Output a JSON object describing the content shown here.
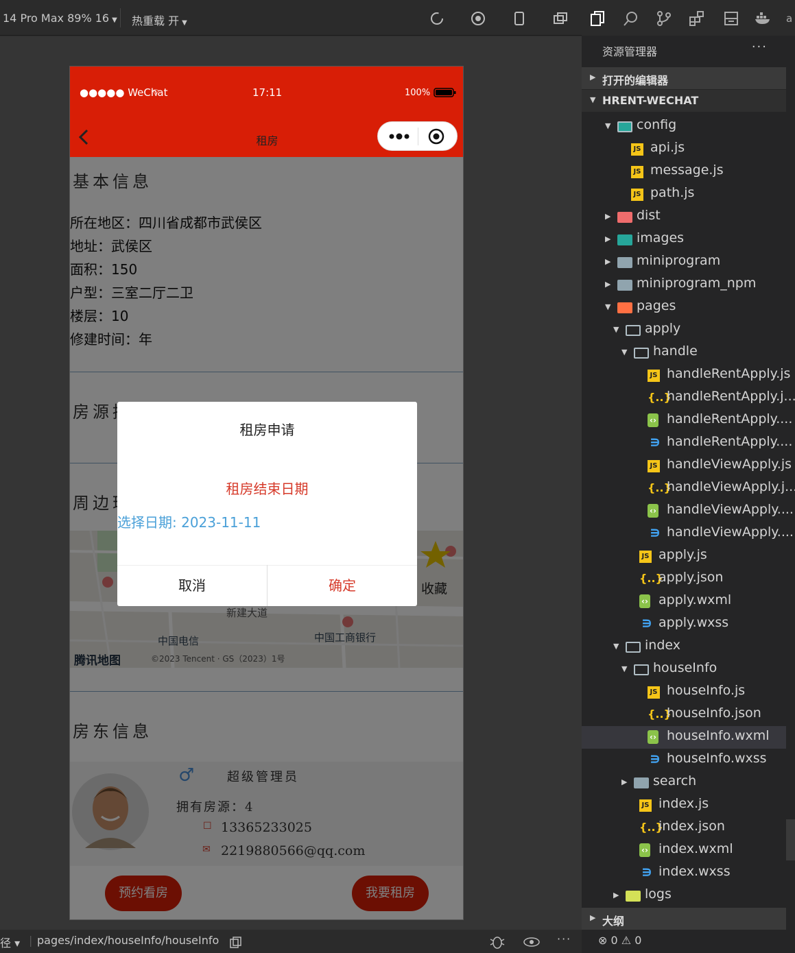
{
  "toolbar": {
    "device": "14 Pro Max 89% 16",
    "hot_reload": "热重载 开"
  },
  "phone": {
    "status": {
      "carrier": "●●●●● WeChat",
      "time": "17:11",
      "battery": "100%"
    },
    "nav_title": "租房",
    "basic": {
      "title": "基本信息",
      "lines": [
        "所在地区：四川省成都市武侯区",
        "地址：武侯区",
        "面积：150",
        "户型：三室二厅二卫",
        "楼层：10",
        "修建时间：年"
      ]
    },
    "desc_title": "房源描述",
    "around_title": "周边环境",
    "map": {
      "road": "新建大道",
      "poi_1": "中国电信",
      "poi_2": "中国工商银行",
      "logo": "腾讯地图",
      "copyright": "©2023 Tencent · GS（2023）1号",
      "favorite": "收藏"
    },
    "landlord": {
      "title": "房东信息",
      "gender_symbol": "♂",
      "name": "超级管理员",
      "listings": "拥有房源：4",
      "phone": "13365233025",
      "email": "2219880566@qq.com"
    },
    "buttons": {
      "view": "预约看房",
      "rent": "我要租房"
    },
    "dialog": {
      "title": "租房申请",
      "subtitle": "租房结束日期",
      "date_label": "选择日期: 2023-11-11",
      "cancel": "取消",
      "confirm": "确定"
    }
  },
  "status_bar": {
    "path": "pages/index/houseInfo/houseInfo",
    "prefix": "径 ▾"
  },
  "explorer": {
    "header": "资源管理器",
    "open_editors": "打开的编辑器",
    "project": "HRENT-WECHAT",
    "outline": "大纲",
    "problems": "⊗ 0 ⚠ 0",
    "tree": [
      {
        "name": "config",
        "type": "folder-config",
        "depth": 1,
        "open": true
      },
      {
        "name": "api.js",
        "type": "js",
        "depth": 2
      },
      {
        "name": "message.js",
        "type": "js",
        "depth": 2
      },
      {
        "name": "path.js",
        "type": "js",
        "depth": 2
      },
      {
        "name": "dist",
        "type": "folder-dist",
        "depth": 1,
        "open": false
      },
      {
        "name": "images",
        "type": "folder-images",
        "depth": 1,
        "open": false
      },
      {
        "name": "miniprogram",
        "type": "folder",
        "depth": 1,
        "open": false
      },
      {
        "name": "miniprogram_npm",
        "type": "folder",
        "depth": 1,
        "open": false
      },
      {
        "name": "pages",
        "type": "folder-pages",
        "depth": 1,
        "open": true
      },
      {
        "name": "apply",
        "type": "folder",
        "depth": 2,
        "open": true
      },
      {
        "name": "handle",
        "type": "folder",
        "depth": 3,
        "open": true
      },
      {
        "name": "handleRentApply.js",
        "type": "js",
        "depth": 4
      },
      {
        "name": "handleRentApply.j...",
        "type": "json",
        "depth": 4
      },
      {
        "name": "handleRentApply....",
        "type": "wxml",
        "depth": 4
      },
      {
        "name": "handleRentApply....",
        "type": "wxss",
        "depth": 4
      },
      {
        "name": "handleViewApply.js",
        "type": "js",
        "depth": 4
      },
      {
        "name": "handleViewApply.j...",
        "type": "json",
        "depth": 4
      },
      {
        "name": "handleViewApply....",
        "type": "wxml",
        "depth": 4
      },
      {
        "name": "handleViewApply....",
        "type": "wxss",
        "depth": 4
      },
      {
        "name": "apply.js",
        "type": "js",
        "depth": 3
      },
      {
        "name": "apply.json",
        "type": "json",
        "depth": 3
      },
      {
        "name": "apply.wxml",
        "type": "wxml",
        "depth": 3
      },
      {
        "name": "apply.wxss",
        "type": "wxss",
        "depth": 3
      },
      {
        "name": "index",
        "type": "folder",
        "depth": 2,
        "open": true
      },
      {
        "name": "houseInfo",
        "type": "folder",
        "depth": 3,
        "open": true
      },
      {
        "name": "houseInfo.js",
        "type": "js",
        "depth": 4
      },
      {
        "name": "houseInfo.json",
        "type": "json",
        "depth": 4
      },
      {
        "name": "houseInfo.wxml",
        "type": "wxml",
        "depth": 4,
        "selected": true
      },
      {
        "name": "houseInfo.wxss",
        "type": "wxss",
        "depth": 4
      },
      {
        "name": "search",
        "type": "folder",
        "depth": 3,
        "open": false
      },
      {
        "name": "index.js",
        "type": "js",
        "depth": 3
      },
      {
        "name": "index.json",
        "type": "json",
        "depth": 3
      },
      {
        "name": "index.wxml",
        "type": "wxml",
        "depth": 3
      },
      {
        "name": "index.wxss",
        "type": "wxss",
        "depth": 3
      },
      {
        "name": "logs",
        "type": "folder-logs",
        "depth": 2,
        "open": false
      }
    ]
  },
  "colors": {
    "wechat_red": "#d81e06",
    "date_blue": "#4aa0d8",
    "dialog_red": "#d63a2a"
  }
}
